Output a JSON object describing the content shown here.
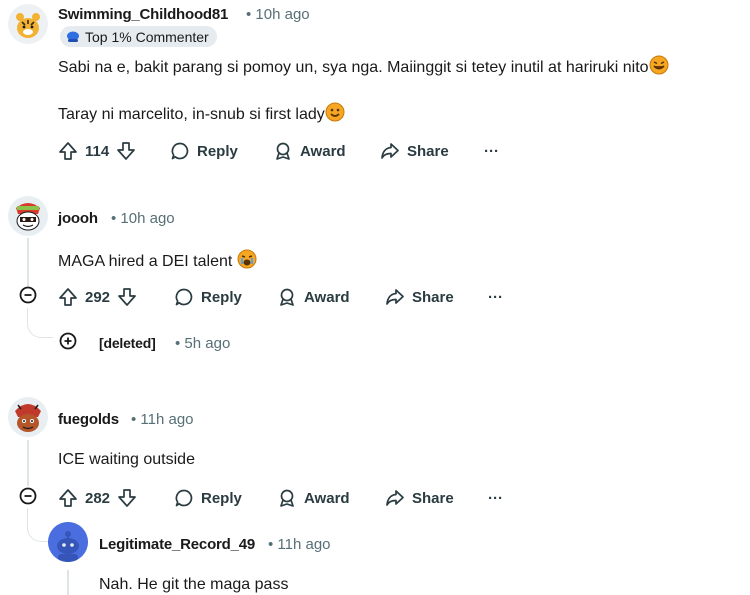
{
  "comments": [
    {
      "username": "Swimming_Childhood81",
      "age": "• 10h ago",
      "badge": "Top 1% Commenter",
      "line1": "Sabi na e, bakit parang si pomoy un, sya nga. Maiinggit si tetey inutil at hariruki nito",
      "line2": "Taray ni marcelito, in-snub si first lady",
      "votes": "114",
      "reply": "Reply",
      "award": "Award",
      "share": "Share",
      "more": "···"
    },
    {
      "username": "joooh",
      "age": "• 10h ago",
      "line1": "MAGA hired a DEI talent",
      "votes": "292",
      "reply": "Reply",
      "award": "Award",
      "share": "Share",
      "more": "···",
      "collapsed_reply": {
        "username": "[deleted]",
        "age": "• 5h ago"
      }
    },
    {
      "username": "fuegolds",
      "age": "• 11h ago",
      "line1": "ICE waiting outside",
      "votes": "282",
      "reply": "Reply",
      "award": "Award",
      "share": "Share",
      "more": "···",
      "reply_comment": {
        "username": "Legitimate_Record_49",
        "age": "• 11h ago",
        "line1": "Nah. He git the maga pass"
      }
    }
  ],
  "icons": {
    "upvote": "upvote-icon",
    "downvote": "downvote-icon",
    "reply": "reply-bubble-icon",
    "award": "award-icon",
    "share": "share-arrow-icon",
    "collapse": "collapse-minus-icon",
    "expand": "expand-plus-icon"
  },
  "colors": {
    "text": "#1a1a1b",
    "meta": "#576f76",
    "badge_bg": "#e5ebee",
    "thread_line": "#dfe4e7",
    "snoo_blue": "#4a6ee0"
  }
}
